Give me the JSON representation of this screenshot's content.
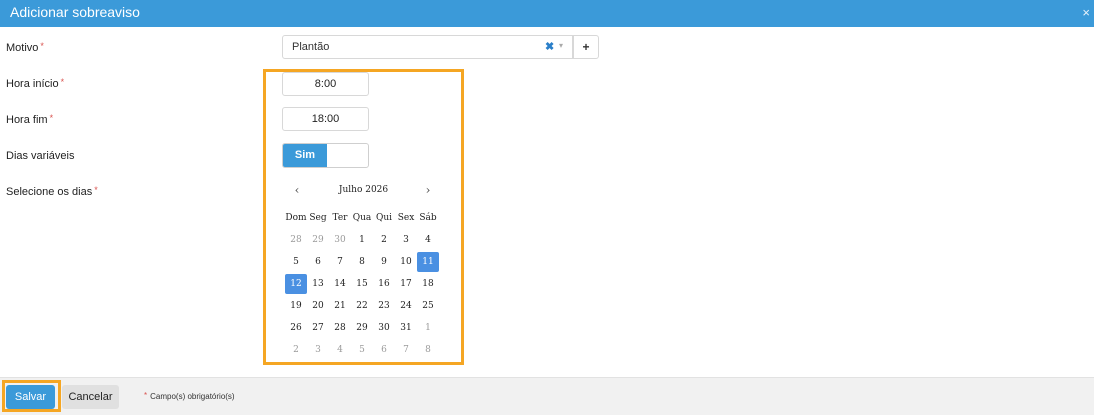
{
  "dialog": {
    "title": "Adicionar sobreaviso",
    "close_icon": "×"
  },
  "form": {
    "motivo": {
      "label": "Motivo",
      "value": "Plantão",
      "clear_icon": "✖",
      "arrow_icon": "▾",
      "add_label": "+"
    },
    "hora_inicio": {
      "label": "Hora início",
      "value": "8:00"
    },
    "hora_fim": {
      "label": "Hora fim",
      "value": "18:00"
    },
    "dias_variaveis": {
      "label": "Dias variáveis",
      "toggle_on_label": "Sim",
      "state": "on"
    },
    "dias": {
      "label": "Selecione os dias"
    },
    "required_marker": "*"
  },
  "calendar": {
    "month_label": "Julho 2026",
    "prev_icon": "‹",
    "next_icon": "›",
    "weekdays": [
      "Dom",
      "Seg",
      "Ter",
      "Qua",
      "Qui",
      "Sex",
      "Sáb"
    ],
    "weeks": [
      [
        {
          "d": "28",
          "m": true
        },
        {
          "d": "29",
          "m": true
        },
        {
          "d": "30",
          "m": true
        },
        {
          "d": "1"
        },
        {
          "d": "2"
        },
        {
          "d": "3"
        },
        {
          "d": "4"
        }
      ],
      [
        {
          "d": "5"
        },
        {
          "d": "6"
        },
        {
          "d": "7"
        },
        {
          "d": "8"
        },
        {
          "d": "9"
        },
        {
          "d": "10"
        },
        {
          "d": "11",
          "s": true
        }
      ],
      [
        {
          "d": "12",
          "s": true
        },
        {
          "d": "13"
        },
        {
          "d": "14"
        },
        {
          "d": "15"
        },
        {
          "d": "16"
        },
        {
          "d": "17"
        },
        {
          "d": "18"
        }
      ],
      [
        {
          "d": "19"
        },
        {
          "d": "20"
        },
        {
          "d": "21"
        },
        {
          "d": "22"
        },
        {
          "d": "23"
        },
        {
          "d": "24"
        },
        {
          "d": "25"
        }
      ],
      [
        {
          "d": "26"
        },
        {
          "d": "27"
        },
        {
          "d": "28"
        },
        {
          "d": "29"
        },
        {
          "d": "30"
        },
        {
          "d": "31"
        },
        {
          "d": "1",
          "m": true
        }
      ],
      [
        {
          "d": "2",
          "m": true
        },
        {
          "d": "3",
          "m": true
        },
        {
          "d": "4",
          "m": true
        },
        {
          "d": "5",
          "m": true
        },
        {
          "d": "6",
          "m": true
        },
        {
          "d": "7",
          "m": true
        },
        {
          "d": "8",
          "m": true
        }
      ]
    ]
  },
  "footer": {
    "save_label": "Salvar",
    "cancel_label": "Cancelar",
    "required_note": "Campo(s) obrigatório(s)"
  },
  "colors": {
    "accent": "#3b9ad9",
    "highlight": "#f5a623",
    "selected_day": "#4a90e2",
    "required": "#d9534f"
  }
}
